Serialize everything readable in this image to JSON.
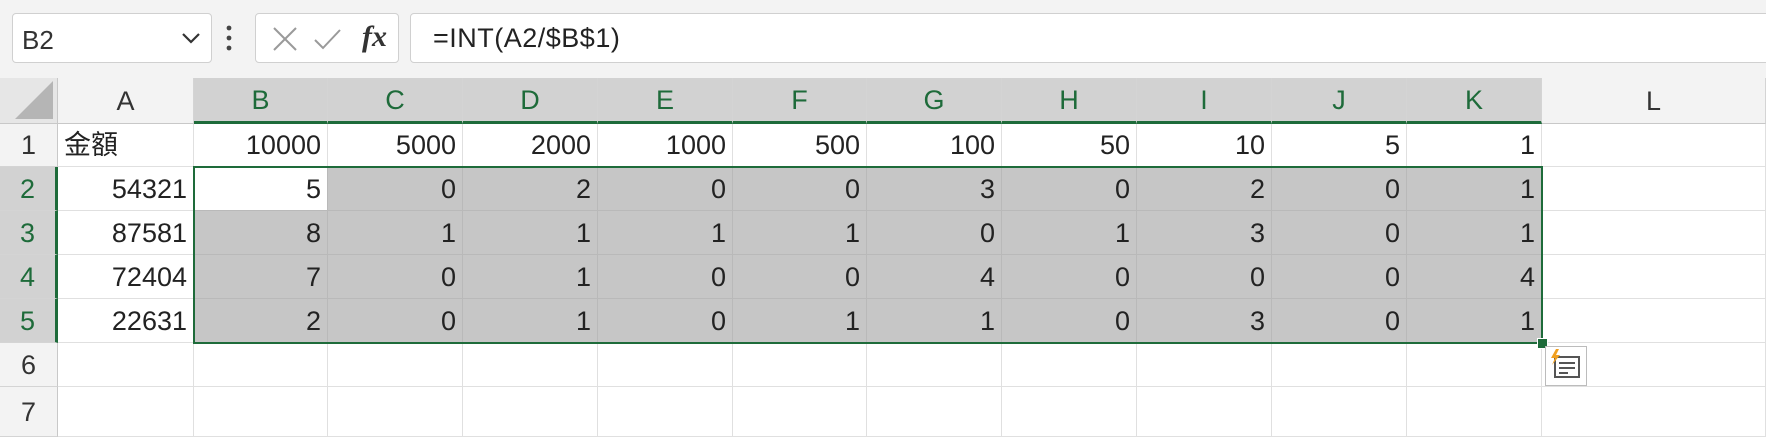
{
  "name_box": {
    "value": "B2"
  },
  "formula_bar": {
    "formula": "=INT(A2/$B$1)",
    "cancel_icon": "cancel-x-icon",
    "enter_icon": "enter-check-icon",
    "function_icon": "fx-icon",
    "function_label": "fx"
  },
  "columns": [
    "A",
    "B",
    "C",
    "D",
    "E",
    "F",
    "G",
    "H",
    "I",
    "J",
    "K",
    "L"
  ],
  "rows": [
    "1",
    "2",
    "3",
    "4",
    "5",
    "6",
    "7"
  ],
  "cells": [
    [
      "金額",
      "10000",
      "5000",
      "2000",
      "1000",
      "500",
      "100",
      "50",
      "10",
      "5",
      "1",
      ""
    ],
    [
      "54321",
      "5",
      "0",
      "2",
      "0",
      "0",
      "3",
      "0",
      "2",
      "0",
      "1",
      ""
    ],
    [
      "87581",
      "8",
      "1",
      "1",
      "1",
      "1",
      "0",
      "1",
      "3",
      "0",
      "1",
      ""
    ],
    [
      "72404",
      "7",
      "0",
      "1",
      "0",
      "0",
      "4",
      "0",
      "0",
      "0",
      "4",
      ""
    ],
    [
      "22631",
      "2",
      "0",
      "1",
      "0",
      "1",
      "1",
      "0",
      "3",
      "0",
      "1",
      ""
    ],
    [
      "",
      "",
      "",
      "",
      "",
      "",
      "",
      "",
      "",
      "",
      "",
      ""
    ],
    [
      "",
      "",
      "",
      "",
      "",
      "",
      "",
      "",
      "",
      "",
      "",
      ""
    ]
  ],
  "selection": {
    "range": "B2:K5",
    "active_cell": "B2"
  },
  "quick_analysis": {
    "icon": "quick-analysis-icon"
  },
  "colors": {
    "accent": "#1e6b3a",
    "selected_fill": "#c6c6c6",
    "header_selected": "#d2d2d2"
  }
}
